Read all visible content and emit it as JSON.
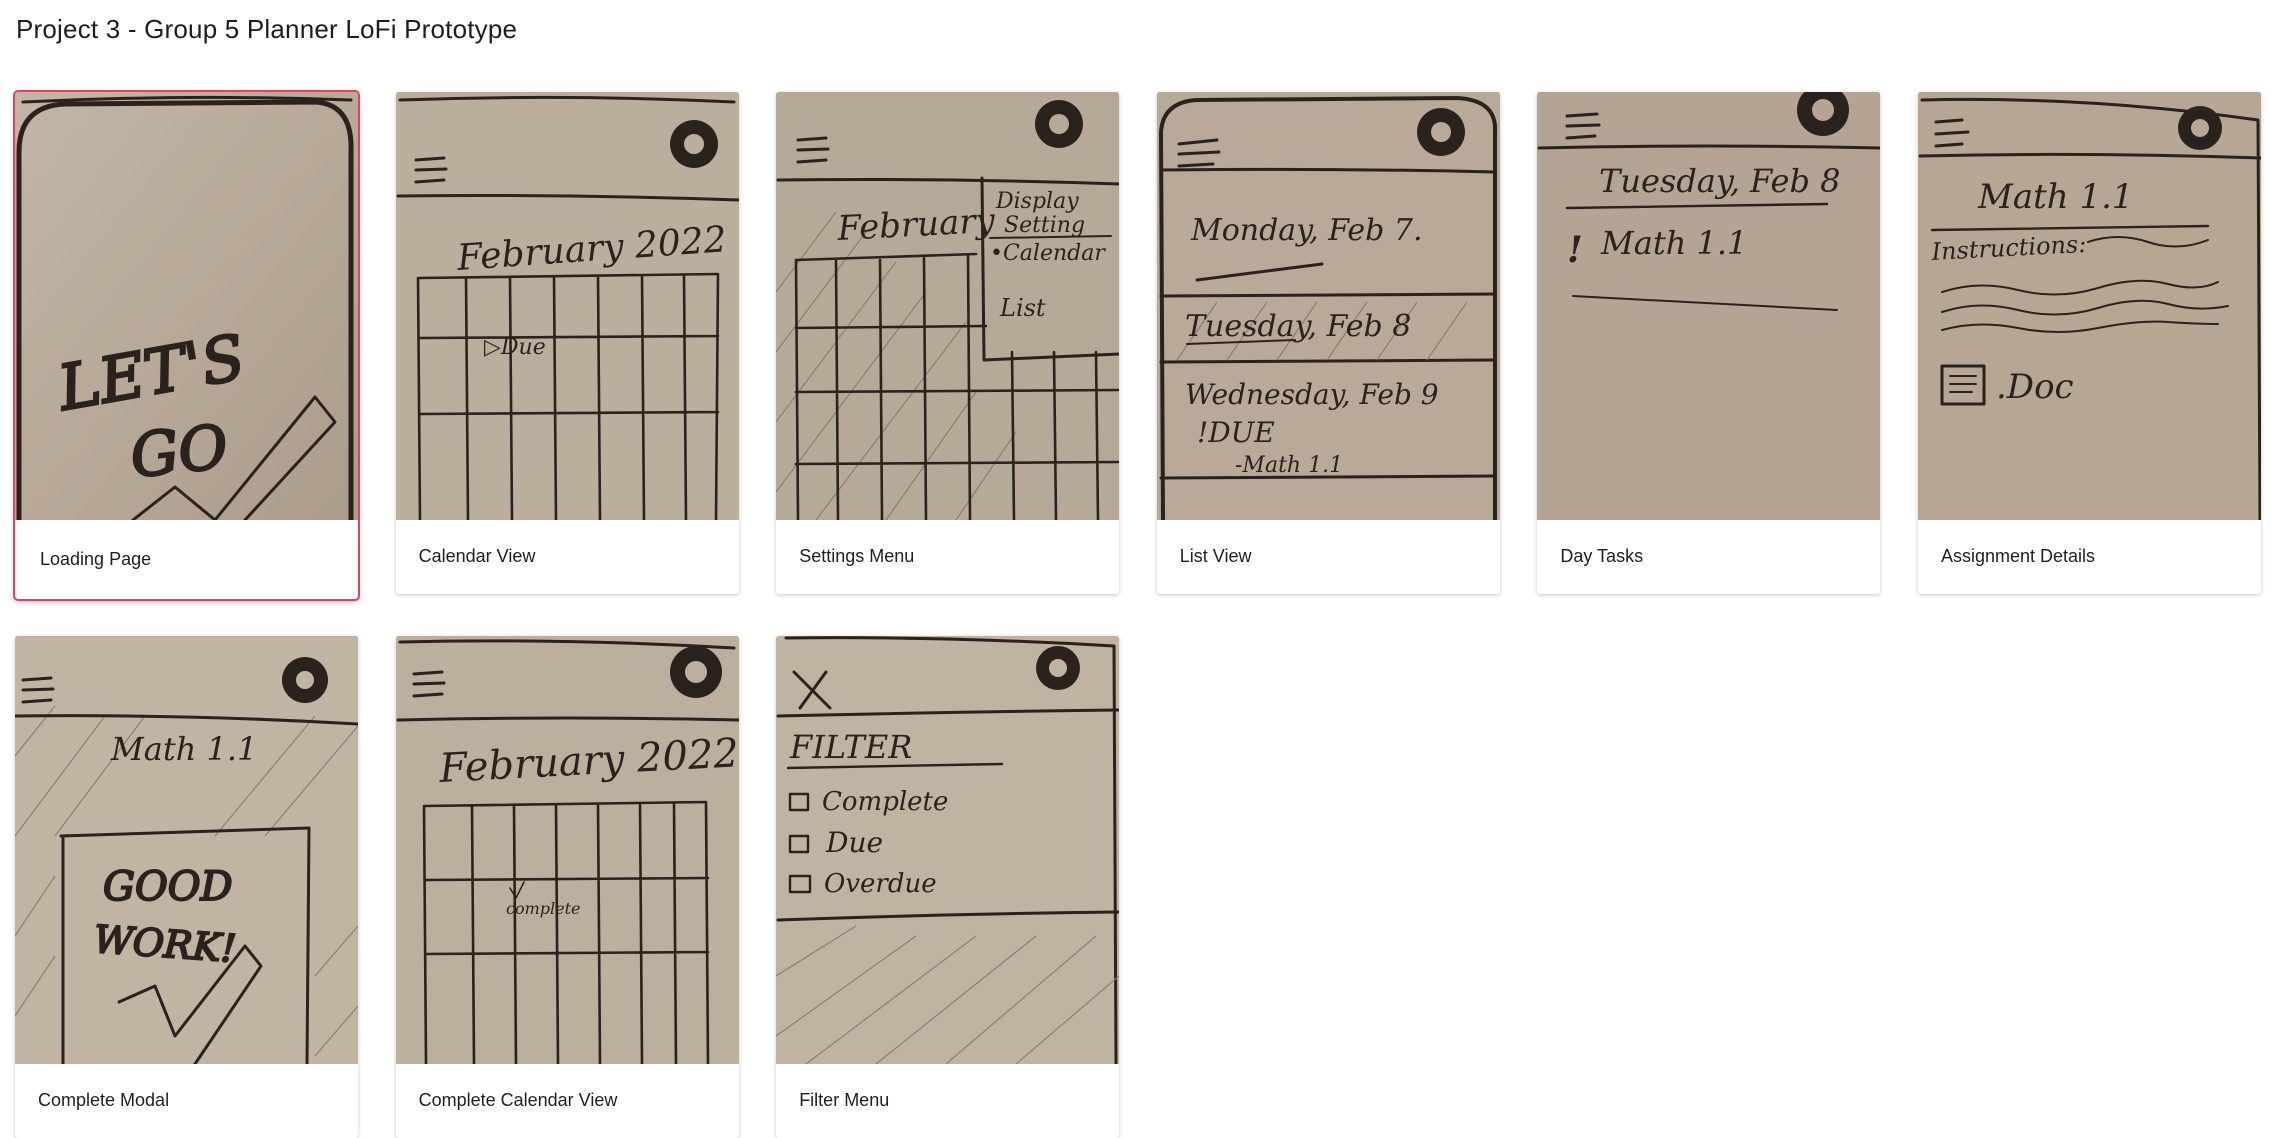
{
  "page": {
    "title": "Project 3 - Group 5 Planner LoFi Prototype"
  },
  "screens": [
    {
      "label": "Loading Page",
      "selected": true,
      "sketch_text": [
        "LET'S",
        "GO"
      ]
    },
    {
      "label": "Calendar View",
      "selected": false,
      "sketch_text": [
        "February 2022",
        "▷Due"
      ]
    },
    {
      "label": "Settings Menu",
      "selected": false,
      "sketch_text": [
        "February",
        "Display",
        "Setting",
        "•Calendar",
        "List"
      ]
    },
    {
      "label": "List View",
      "selected": false,
      "sketch_text": [
        "Monday, Feb 7.",
        "Tuesday, Feb 8",
        "Wednesday, Feb 9",
        "!DUE",
        "-Math 1.1"
      ]
    },
    {
      "label": "Day Tasks",
      "selected": false,
      "sketch_text": [
        "Tuesday, Feb 8",
        "!",
        "Math 1.1"
      ]
    },
    {
      "label": "Assignment Details",
      "selected": false,
      "sketch_text": [
        "Math 1.1",
        "Instructions:",
        ".Doc"
      ]
    },
    {
      "label": "Complete Modal",
      "selected": false,
      "sketch_text": [
        "Math 1.1",
        "GOOD",
        "WORK!"
      ]
    },
    {
      "label": "Complete Calendar View",
      "selected": false,
      "sketch_text": [
        "February 2022",
        "complete"
      ]
    },
    {
      "label": "Filter Menu",
      "selected": false,
      "sketch_text": [
        "FILTER",
        "Complete",
        "Due",
        "Overdue"
      ]
    }
  ],
  "colors": {
    "selected_border": "#e5405e",
    "paper": "#b9aa99",
    "ink": "#2a231d"
  },
  "icons": {
    "menu": "hamburger-icon",
    "settings": "gear-icon",
    "close": "close-icon",
    "checkbox": "checkbox-icon",
    "document": "document-icon",
    "checkmark": "checkmark-icon"
  }
}
